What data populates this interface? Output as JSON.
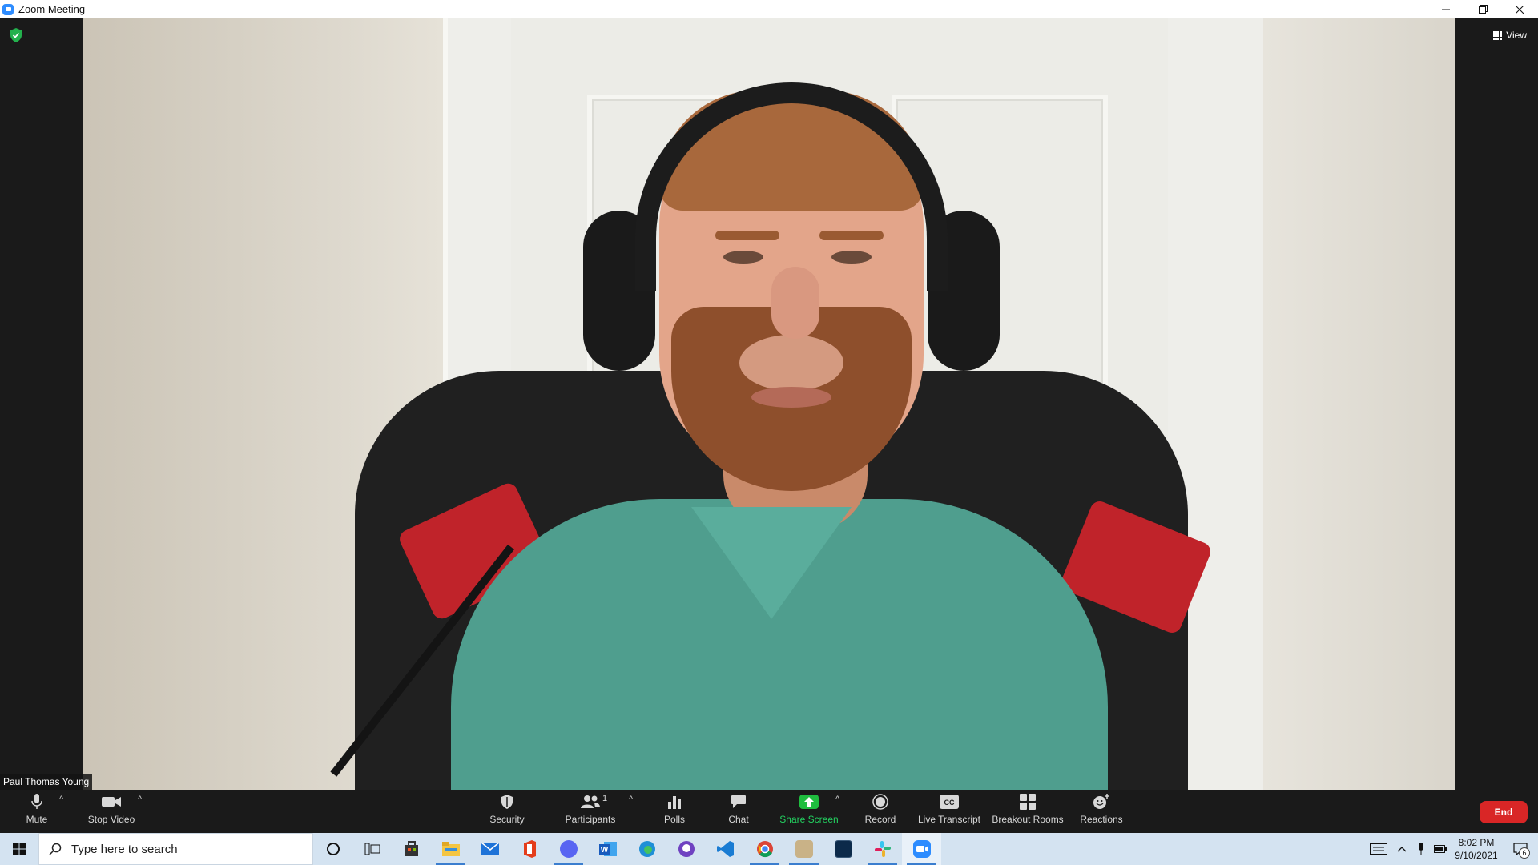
{
  "window": {
    "title": "Zoom Meeting"
  },
  "meeting": {
    "view_label": "View",
    "participant_name": "Paul Thomas Young"
  },
  "toolbar": {
    "mute": "Mute",
    "stop_video": "Stop Video",
    "security": "Security",
    "participants": "Participants",
    "participants_count": "1",
    "polls": "Polls",
    "chat": "Chat",
    "share_screen": "Share Screen",
    "record": "Record",
    "live_transcript": "Live Transcript",
    "breakout_rooms": "Breakout Rooms",
    "reactions": "Reactions",
    "end": "End",
    "colors": {
      "share": "#1fbd3f",
      "end": "#d92626"
    }
  },
  "taskbar": {
    "search_placeholder": "Type here to search",
    "apps": [
      "cortana-icon",
      "task-view-icon",
      "store-icon",
      "file-explorer-icon",
      "mail-icon",
      "office-icon",
      "discord-icon",
      "word-icon",
      "edge-icon",
      "github-desktop-icon",
      "vscode-icon",
      "chrome-icon",
      "app-icon",
      "terminal-icon",
      "slack-icon",
      "zoom-icon"
    ],
    "time": "8:02 PM",
    "date": "9/10/2021",
    "notification_count": "6"
  }
}
